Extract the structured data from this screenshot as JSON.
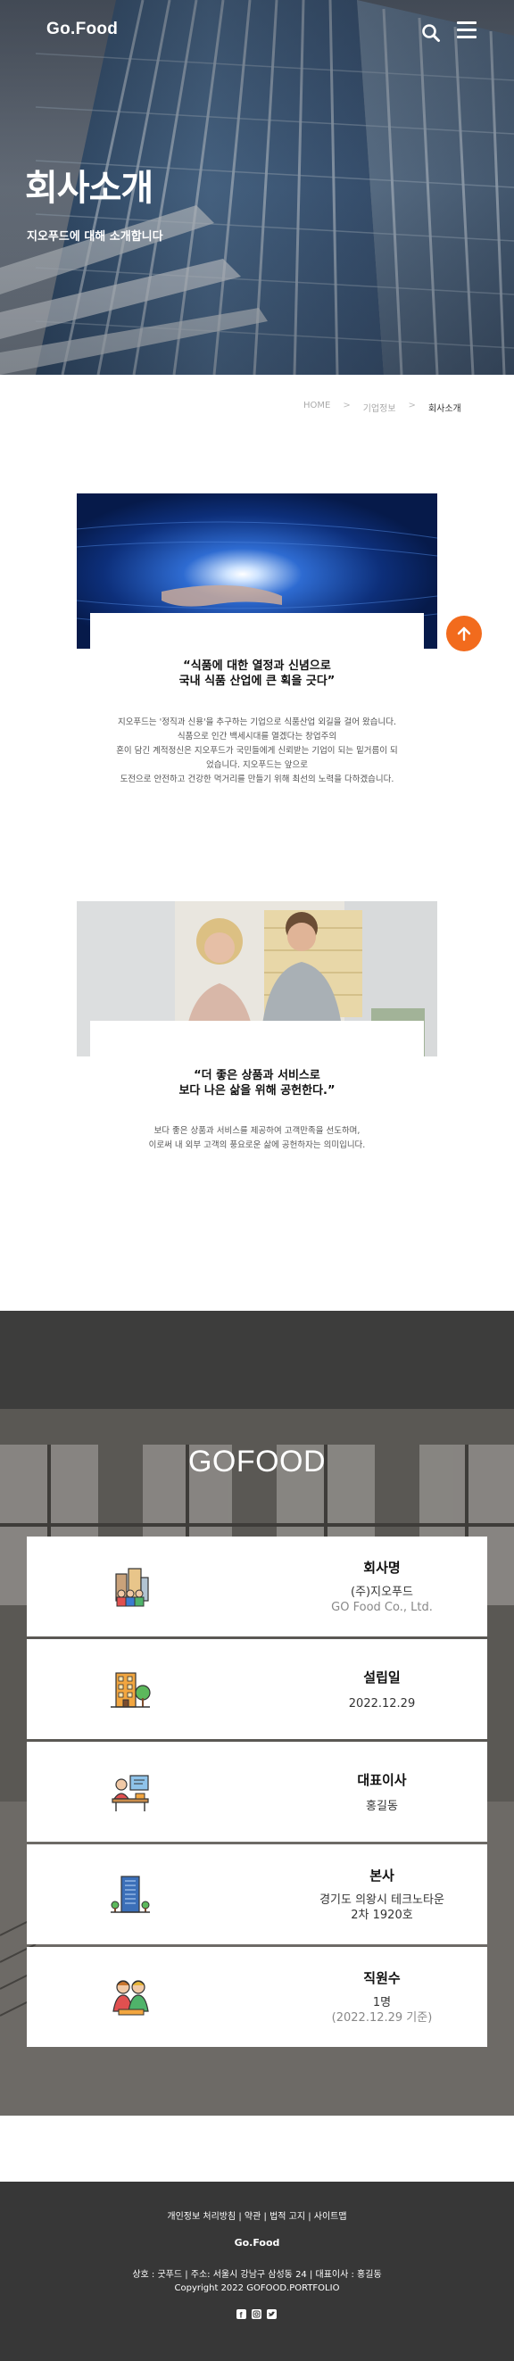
{
  "header": {
    "logo": "Go.Food",
    "search_icon": "search-icon",
    "menu_icon": "hamburger-icon"
  },
  "hero": {
    "title": "회사소개",
    "subtitle": "지오푸드에 대해 소개합니다"
  },
  "breadcrumb": [
    "HOME",
    "기업정보",
    "회사소개"
  ],
  "stories": [
    {
      "quote_line1": "“식품에 대한 열정과 신념으로",
      "quote_line2": "국내 식품 산업에 큰 획을 긋다”",
      "body": [
        "지오푸드는 '정직과 신용'을 추구하는 기업으로 식품산업 외길을 걸어 왔습니다.",
        "식품으로 인간 백세시대를 열겠다는 창업주의",
        "혼이 담긴 계적정신은 지오푸드가 국민들에게 신뢰받는 기업이 되는 밑거름이 되",
        "었습니다. 지오푸드는 앞으로",
        "도전으로 안전하고 건강한 먹거리를 만들기 위해 최선의 노력을 다하겠습니다."
      ]
    },
    {
      "quote_line1": "“더 좋은 상품과 서비스로",
      "quote_line2": "보다 나은 삶을 위해 공헌한다.”",
      "body": [
        "보다 좋은 상품과 서비스를 제공하여 고객만족을 선도하며,",
        "이로써 내 외부 고객의 풍요로운 삶에 공헌하자는 의미입니다."
      ]
    }
  ],
  "scroll_top_icon": "arrow-up-icon",
  "info": {
    "title": "GOFOOD",
    "cards": [
      {
        "label": "회사명",
        "value": "(주)지오푸드",
        "value2": "GO Food Co., Ltd.",
        "icon": "people-building-icon"
      },
      {
        "label": "설립일",
        "value": "2022.12.29",
        "value2": "",
        "icon": "building-tree-icon"
      },
      {
        "label": "대표이사",
        "value": "홍길동",
        "value2": "",
        "icon": "ceo-desk-icon"
      },
      {
        "label": "본사",
        "value": "경기도 의왕시 테크노타운",
        "value2": "2차 1920호",
        "icon": "skyscraper-icon"
      },
      {
        "label": "직원수",
        "value": "1명",
        "value2": "(2022.12.29 기준)",
        "icon": "employees-icon"
      }
    ]
  },
  "footer": {
    "links": [
      "개인정보 처리방침",
      "약관",
      "법적 고지",
      "사이트맵"
    ],
    "logo": "Go.Food",
    "address": "상호 : 굿푸드 | 주소: 서울시 강남구 삼성동 24 | 대표이사 : 홍길동",
    "copyright": "Copyright 2022 GOFOOD.PORTFOLIO",
    "socials": [
      "facebook-icon",
      "instagram-icon",
      "twitter-icon"
    ]
  },
  "colors": {
    "accent": "#f26b1d",
    "footer_bg": "#373737"
  }
}
